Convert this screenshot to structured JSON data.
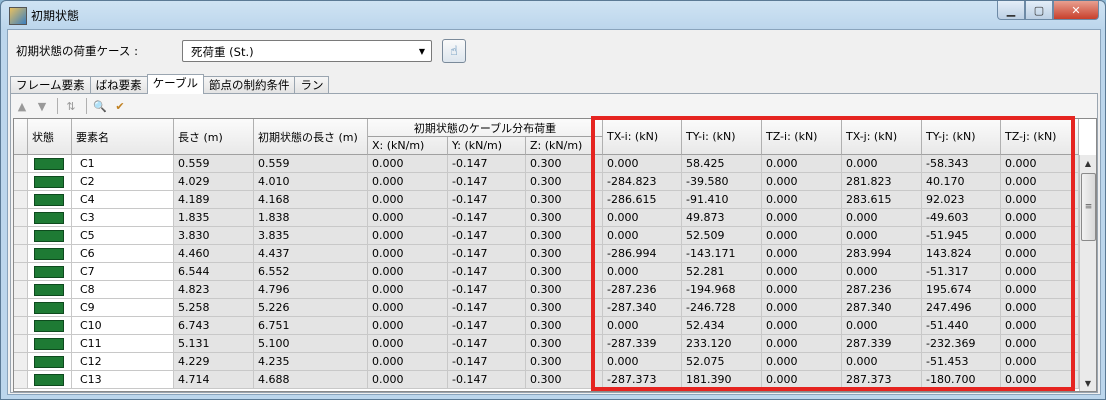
{
  "window": {
    "title": "初期状態"
  },
  "load_case": {
    "label": "初期状態の荷重ケース :",
    "selected": "死荷重 (St.)"
  },
  "tabs": [
    {
      "label": "フレーム要素"
    },
    {
      "label": "ばね要素"
    },
    {
      "label": "ケーブル"
    },
    {
      "label": "節点の制約条件"
    },
    {
      "label": "ラン"
    }
  ],
  "icons": {
    "app": "app-icon",
    "minimize": "minimize-icon",
    "maximize": "maximize-icon",
    "close": "close-icon",
    "pick": "pick-icon",
    "up": "move-up-icon",
    "down": "move-down-icon",
    "sort": "sort-icon",
    "zoom": "zoom-icon",
    "check": "check-icon"
  },
  "grid": {
    "group_header": "初期状態のケーブル分布荷重",
    "columns": [
      "状態",
      "要素名",
      "長さ (m)",
      "初期状態の長さ (m)",
      "X: (kN/m)",
      "Y: (kN/m)",
      "Z: (kN/m)",
      "TX-i: (kN)",
      "TY-i: (kN)",
      "TZ-i: (kN)",
      "TX-j: (kN)",
      "TY-j: (kN)",
      "TZ-j: (kN)"
    ],
    "status_color": "#1e7a34",
    "rows": [
      {
        "name": "C1",
        "len": "0.559",
        "init_len": "0.559",
        "x": "0.000",
        "y": "-0.147",
        "z": "0.300",
        "txi": "0.000",
        "tyi": "58.425",
        "tzi": "0.000",
        "txj": "0.000",
        "tyj": "-58.343",
        "tzj": "0.000"
      },
      {
        "name": "C2",
        "len": "4.029",
        "init_len": "4.010",
        "x": "0.000",
        "y": "-0.147",
        "z": "0.300",
        "txi": "-284.823",
        "tyi": "-39.580",
        "tzi": "0.000",
        "txj": "281.823",
        "tyj": "40.170",
        "tzj": "0.000"
      },
      {
        "name": "C4",
        "len": "4.189",
        "init_len": "4.168",
        "x": "0.000",
        "y": "-0.147",
        "z": "0.300",
        "txi": "-286.615",
        "tyi": "-91.410",
        "tzi": "0.000",
        "txj": "283.615",
        "tyj": "92.023",
        "tzj": "0.000"
      },
      {
        "name": "C3",
        "len": "1.835",
        "init_len": "1.838",
        "x": "0.000",
        "y": "-0.147",
        "z": "0.300",
        "txi": "0.000",
        "tyi": "49.873",
        "tzi": "0.000",
        "txj": "0.000",
        "tyj": "-49.603",
        "tzj": "0.000"
      },
      {
        "name": "C5",
        "len": "3.830",
        "init_len": "3.835",
        "x": "0.000",
        "y": "-0.147",
        "z": "0.300",
        "txi": "0.000",
        "tyi": "52.509",
        "tzi": "0.000",
        "txj": "0.000",
        "tyj": "-51.945",
        "tzj": "0.000"
      },
      {
        "name": "C6",
        "len": "4.460",
        "init_len": "4.437",
        "x": "0.000",
        "y": "-0.147",
        "z": "0.300",
        "txi": "-286.994",
        "tyi": "-143.171",
        "tzi": "0.000",
        "txj": "283.994",
        "tyj": "143.824",
        "tzj": "0.000"
      },
      {
        "name": "C7",
        "len": "6.544",
        "init_len": "6.552",
        "x": "0.000",
        "y": "-0.147",
        "z": "0.300",
        "txi": "0.000",
        "tyi": "52.281",
        "tzi": "0.000",
        "txj": "0.000",
        "tyj": "-51.317",
        "tzj": "0.000"
      },
      {
        "name": "C8",
        "len": "4.823",
        "init_len": "4.796",
        "x": "0.000",
        "y": "-0.147",
        "z": "0.300",
        "txi": "-287.236",
        "tyi": "-194.968",
        "tzi": "0.000",
        "txj": "287.236",
        "tyj": "195.674",
        "tzj": "0.000"
      },
      {
        "name": "C9",
        "len": "5.258",
        "init_len": "5.226",
        "x": "0.000",
        "y": "-0.147",
        "z": "0.300",
        "txi": "-287.340",
        "tyi": "-246.728",
        "tzi": "0.000",
        "txj": "287.340",
        "tyj": "247.496",
        "tzj": "0.000"
      },
      {
        "name": "C10",
        "len": "6.743",
        "init_len": "6.751",
        "x": "0.000",
        "y": "-0.147",
        "z": "0.300",
        "txi": "0.000",
        "tyi": "52.434",
        "tzi": "0.000",
        "txj": "0.000",
        "tyj": "-51.440",
        "tzj": "0.000"
      },
      {
        "name": "C11",
        "len": "5.131",
        "init_len": "5.100",
        "x": "0.000",
        "y": "-0.147",
        "z": "0.300",
        "txi": "-287.339",
        "tyi": "233.120",
        "tzi": "0.000",
        "txj": "287.339",
        "tyj": "-232.369",
        "tzj": "0.000"
      },
      {
        "name": "C12",
        "len": "4.229",
        "init_len": "4.235",
        "x": "0.000",
        "y": "-0.147",
        "z": "0.300",
        "txi": "0.000",
        "tyi": "52.075",
        "tzi": "0.000",
        "txj": "0.000",
        "tyj": "-51.453",
        "tzj": "0.000"
      },
      {
        "name": "C13",
        "len": "4.714",
        "init_len": "4.688",
        "x": "0.000",
        "y": "-0.147",
        "z": "0.300",
        "txi": "-287.373",
        "tyi": "181.390",
        "tzi": "0.000",
        "txj": "287.373",
        "tyj": "-180.700",
        "tzj": "0.000"
      }
    ]
  },
  "annotation": {
    "highlight_color": "#e52420"
  }
}
